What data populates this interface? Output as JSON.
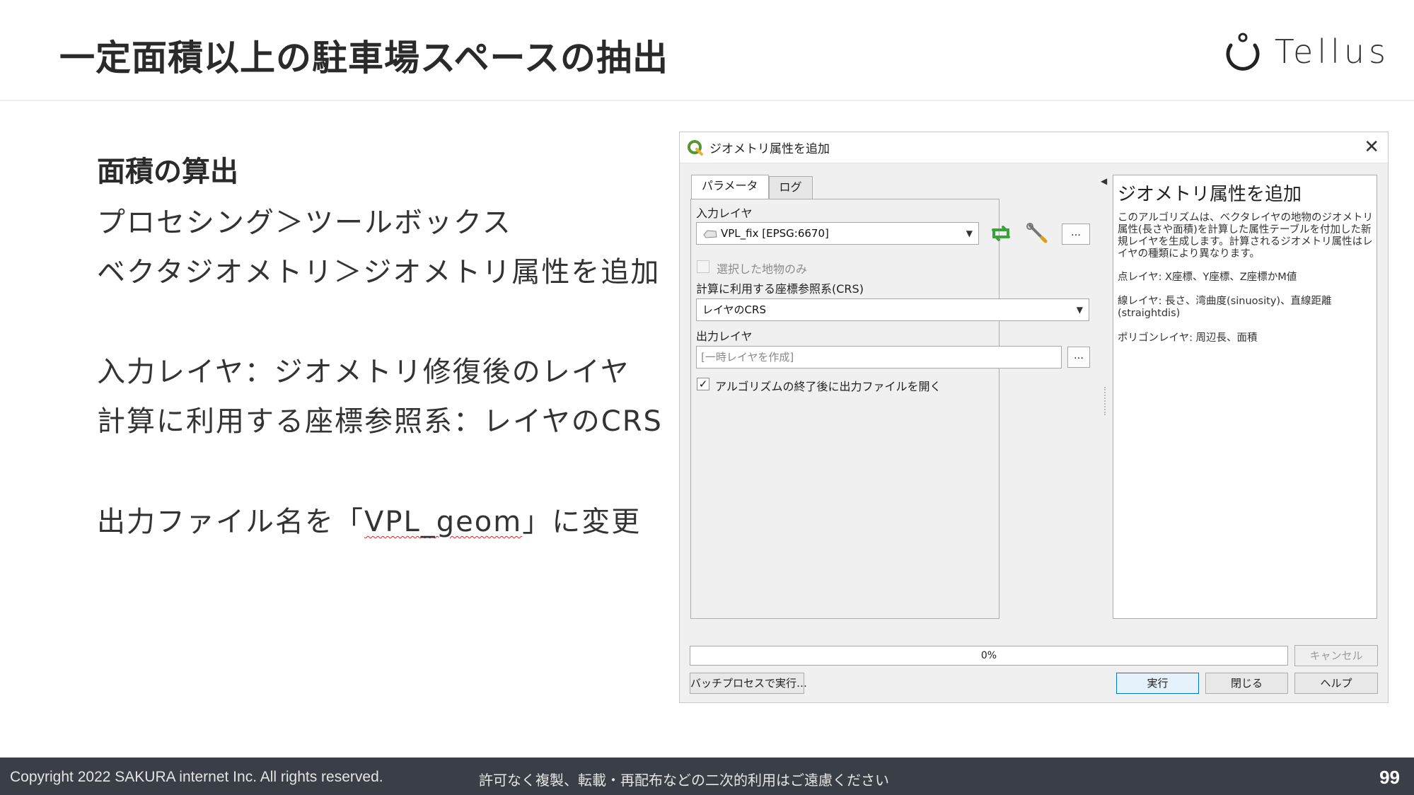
{
  "slide": {
    "title": "一定面積以上の駐車場スペースの抽出",
    "brand": "Tellus"
  },
  "content": {
    "heading": "面積の算出",
    "line1": "プロセシング＞ツールボックス",
    "line2": "ベクタジオメトリ＞ジオメトリ属性を追加",
    "line3": "入力レイヤ：ジオメトリ修復後のレイヤ",
    "line4": "計算に利用する座標参照系：レイヤのCRS",
    "line5_prefix": "出力ファイル名を「",
    "line5_value": "VPL_geom",
    "line5_suffix": "」に変更"
  },
  "dialog": {
    "title": "ジオメトリ属性を追加",
    "tabs": [
      "パラメータ",
      "ログ"
    ],
    "input_layer_label": "入力レイヤ",
    "input_layer_value": "VPL_fix [EPSG:6670]",
    "options_button": "…",
    "selected_only_label": "選択した地物のみ",
    "crs_label": "計算に利用する座標参照系(CRS)",
    "crs_value": "レイヤのCRS",
    "output_label": "出力レイヤ",
    "output_placeholder": "[一時レイヤを作成]",
    "browse_button": "…",
    "open_after_label": "アルゴリズムの終了後に出力ファイルを開く",
    "open_after_checked": "✓",
    "progress": "0%",
    "cancel_button": "キャンセル",
    "batch_button": "バッチプロセスで実行…",
    "run_button": "実行",
    "close_button": "閉じる",
    "help_button": "ヘルプ",
    "help": {
      "title": "ジオメトリ属性を追加",
      "description": "このアルゴリズムは、ベクタレイヤの地物のジオメトリ属性(長さや面積)を計算した属性テーブルを付加した新規レイヤを生成します。計算されるジオメトリ属性はレイヤの種類により異なります。",
      "points": "点レイヤ: X座標、Y座標、Z座標かM値",
      "lines": "線レイヤ: 長さ、湾曲度(sinuosity)、直線距離(straightdis)",
      "polygons": "ポリゴンレイヤ: 周辺長、面積"
    }
  },
  "footer": {
    "copyright": "Copyright 2022 SAKURA internet Inc. All rights reserved.",
    "notice": "許可なく複製、転載・再配布などの二次的利用はご遠慮ください",
    "page": "99"
  },
  "colors": {
    "footer_bg": "#3a3e46",
    "qgis_green": "#589632",
    "refresh_green": "#3aa43a"
  }
}
